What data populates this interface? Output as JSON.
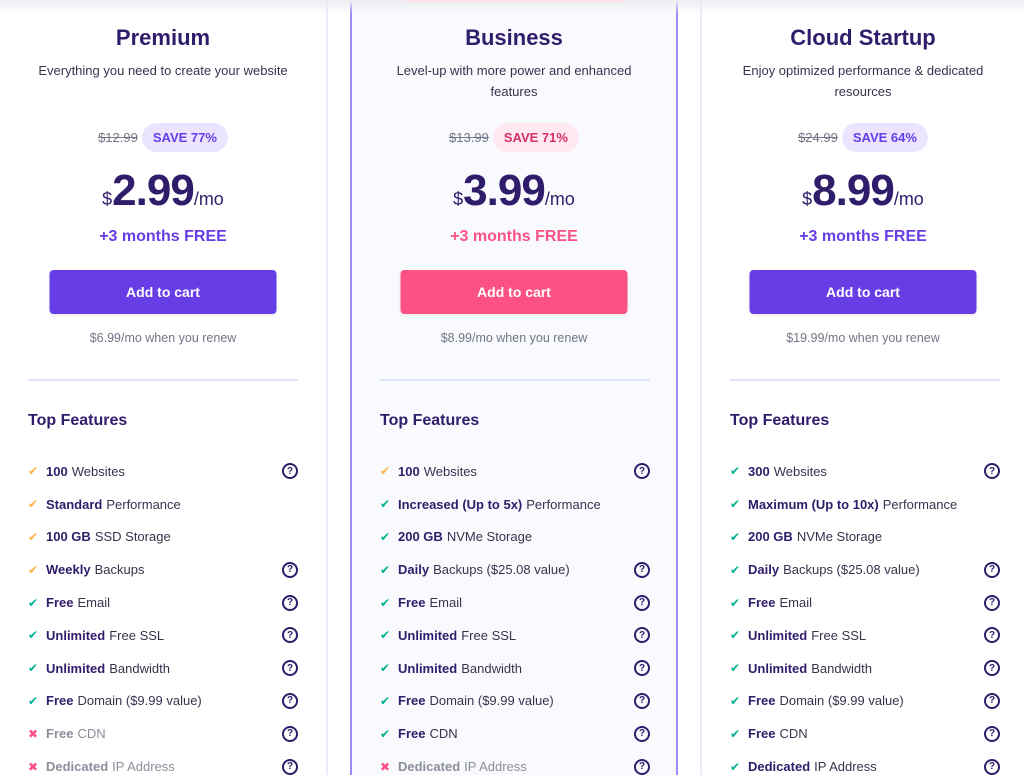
{
  "colors": {
    "primary": "#673de6",
    "accent_pink": "#fc5185",
    "text_dark": "#2f1c6a",
    "check_green": "#00b090",
    "check_yellow": "#ffb340",
    "cross_red": "#fc5185"
  },
  "plans": [
    {
      "name": "Premium",
      "description": "Everything you need to create your website",
      "old_price": "$12.99",
      "save_badge": "SAVE 77%",
      "currency": "$",
      "price": "2.99",
      "period": "/mo",
      "bonus": "+3 months FREE",
      "cta": "Add to cart",
      "renew_text": "$6.99/mo when you renew",
      "features_title": "Top Features",
      "features": [
        {
          "bold": "100",
          "text": "Websites",
          "status": "partial",
          "help": true
        },
        {
          "bold": "Standard",
          "text": "Performance",
          "status": "partial",
          "help": false
        },
        {
          "bold": "100 GB",
          "text": "SSD Storage",
          "status": "partial",
          "help": false
        },
        {
          "bold": "Weekly",
          "text": "Backups",
          "status": "partial",
          "help": true
        },
        {
          "bold": "Free",
          "text": "Email",
          "status": "included",
          "help": true
        },
        {
          "bold": "Unlimited",
          "text": "Free SSL",
          "status": "included",
          "help": true
        },
        {
          "bold": "Unlimited",
          "text": "Bandwidth",
          "status": "included",
          "help": true
        },
        {
          "bold": "Free",
          "text": "Domain ($9.99 value)",
          "status": "included",
          "help": true
        },
        {
          "bold": "Free",
          "text": "CDN",
          "status": "excluded",
          "help": true
        },
        {
          "bold": "Dedicated",
          "text": "IP Address",
          "status": "excluded",
          "help": true
        }
      ]
    },
    {
      "name": "Business",
      "description": "Level-up with more power and enhanced features",
      "old_price": "$13.99",
      "save_badge": "SAVE 71%",
      "currency": "$",
      "price": "3.99",
      "period": "/mo",
      "bonus": "+3 months FREE",
      "cta": "Add to cart",
      "renew_text": "$8.99/mo when you renew",
      "features_title": "Top Features",
      "features": [
        {
          "bold": "100",
          "text": "Websites",
          "status": "partial",
          "help": true
        },
        {
          "bold": "Increased (Up to 5x)",
          "text": "Performance",
          "status": "included",
          "help": false
        },
        {
          "bold": "200 GB",
          "text": "NVMe Storage",
          "status": "included",
          "help": false
        },
        {
          "bold": "Daily",
          "text": "Backups ($25.08 value)",
          "status": "included",
          "help": true
        },
        {
          "bold": "Free",
          "text": "Email",
          "status": "included",
          "help": true
        },
        {
          "bold": "Unlimited",
          "text": "Free SSL",
          "status": "included",
          "help": true
        },
        {
          "bold": "Unlimited",
          "text": "Bandwidth",
          "status": "included",
          "help": true
        },
        {
          "bold": "Free",
          "text": "Domain ($9.99 value)",
          "status": "included",
          "help": true
        },
        {
          "bold": "Free",
          "text": "CDN",
          "status": "included",
          "help": true
        },
        {
          "bold": "Dedicated",
          "text": "IP Address",
          "status": "excluded",
          "help": true
        }
      ]
    },
    {
      "name": "Cloud Startup",
      "description": "Enjoy optimized performance & dedicated resources",
      "old_price": "$24.99",
      "save_badge": "SAVE 64%",
      "currency": "$",
      "price": "8.99",
      "period": "/mo",
      "bonus": "+3 months FREE",
      "cta": "Add to cart",
      "renew_text": "$19.99/mo when you renew",
      "features_title": "Top Features",
      "features": [
        {
          "bold": "300",
          "text": "Websites",
          "status": "included",
          "help": true
        },
        {
          "bold": "Maximum (Up to 10x)",
          "text": "Performance",
          "status": "included",
          "help": false
        },
        {
          "bold": "200 GB",
          "text": "NVMe Storage",
          "status": "included",
          "help": false
        },
        {
          "bold": "Daily",
          "text": "Backups ($25.08 value)",
          "status": "included",
          "help": true
        },
        {
          "bold": "Free",
          "text": "Email",
          "status": "included",
          "help": true
        },
        {
          "bold": "Unlimited",
          "text": "Free SSL",
          "status": "included",
          "help": true
        },
        {
          "bold": "Unlimited",
          "text": "Bandwidth",
          "status": "included",
          "help": true
        },
        {
          "bold": "Free",
          "text": "Domain ($9.99 value)",
          "status": "included",
          "help": true
        },
        {
          "bold": "Free",
          "text": "CDN",
          "status": "included",
          "help": true
        },
        {
          "bold": "Dedicated",
          "text": "IP Address",
          "status": "included",
          "help": true
        }
      ]
    }
  ],
  "icons": {
    "check": "✔",
    "cross": "✖",
    "help": "?"
  }
}
